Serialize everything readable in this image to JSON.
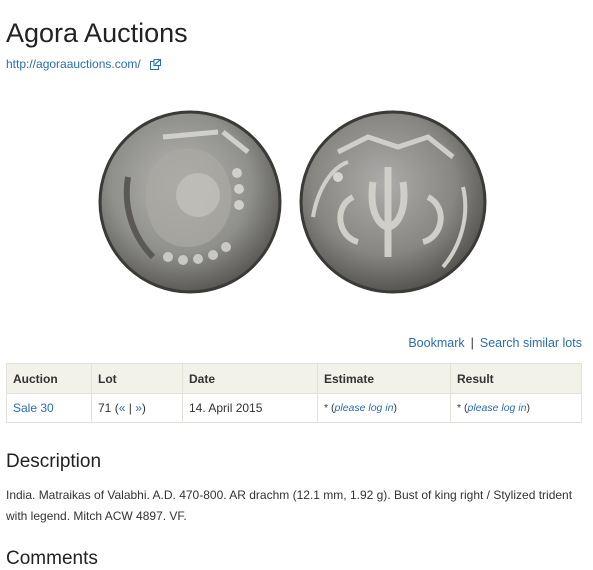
{
  "site": {
    "title": "Agora Auctions",
    "url": "http://agoraauctions.com/",
    "external_icon": "external-link-icon"
  },
  "actions": {
    "bookmark": "Bookmark",
    "separator": "|",
    "search_similar": "Search similar lots"
  },
  "table": {
    "headers": {
      "auction": "Auction",
      "lot": "Lot",
      "date": "Date",
      "estimate": "Estimate",
      "result": "Result"
    },
    "row": {
      "auction": "Sale 30",
      "lot": "71",
      "lot_prev": "«",
      "lot_sep": "|",
      "lot_next": "»",
      "date": "14. April 2015",
      "estimate_prefix": "*",
      "estimate_link": "please log in",
      "result_prefix": "*",
      "result_link": "please log in"
    }
  },
  "description": {
    "heading": "Description",
    "text": "India. Matraikas of Valabhi. A.D. 470-800. AR drachm (12.1 mm, 1.92 g). Bust of king right / Stylized trident with legend. Mitch ACW 4897. VF."
  },
  "comments": {
    "heading": "Comments"
  },
  "colors": {
    "link": "#2a6db0",
    "table_header_bg": "#f2f1ea",
    "coin_silver": "#8f8f8c"
  }
}
